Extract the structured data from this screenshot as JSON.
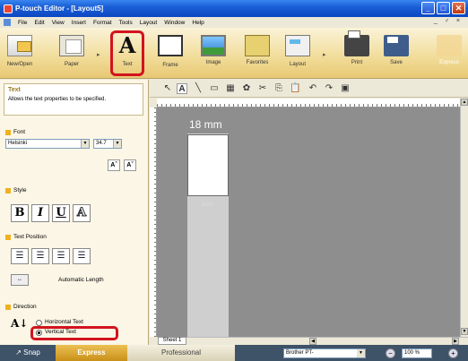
{
  "window": {
    "title": "P-touch Editor - [Layout5]",
    "buttons": [
      "_",
      "□",
      "✕"
    ]
  },
  "menu": {
    "items": [
      "File",
      "Edit",
      "View",
      "Insert",
      "Format",
      "Tools",
      "Layout",
      "Window",
      "Help"
    ],
    "mdi_controls": "_ ♂ ×"
  },
  "ribbon": {
    "new_open": "New/Open",
    "paper": "Paper",
    "text": "Text",
    "frame": "Frame",
    "image": "Image",
    "favorites": "Favorites",
    "layout": "Layout",
    "print": "Print",
    "save": "Save",
    "express": "Express"
  },
  "pane": {
    "title": "Text",
    "description": "Allows the text properties to be specified.",
    "font_section": "Font",
    "font_name": "Helsinki",
    "font_size": "34.7",
    "grow": "Aˆ",
    "shrink": "Aˇ",
    "style_section": "Style",
    "bold": "B",
    "italic": "I",
    "underline": "U",
    "outline": "A",
    "position_section": "Text Position",
    "auto_length_label": "Automatic Length",
    "direction_section": "Direction",
    "horizontal": "Horizontal Text",
    "vertical": "Vertical Text",
    "vertical_selected": true
  },
  "canvas": {
    "tape_width": "18 mm",
    "auto_label": "Auto",
    "sheet_tab": "Sheet 1"
  },
  "status": {
    "snap": "Snap",
    "express": "Express",
    "professional": "Professional",
    "printer": "Brother PT-",
    "zoom": "100 %"
  },
  "colors": {
    "highlight": "#d2141e",
    "ribbon": "#f1dc98",
    "express_mode": "#ecc054"
  }
}
